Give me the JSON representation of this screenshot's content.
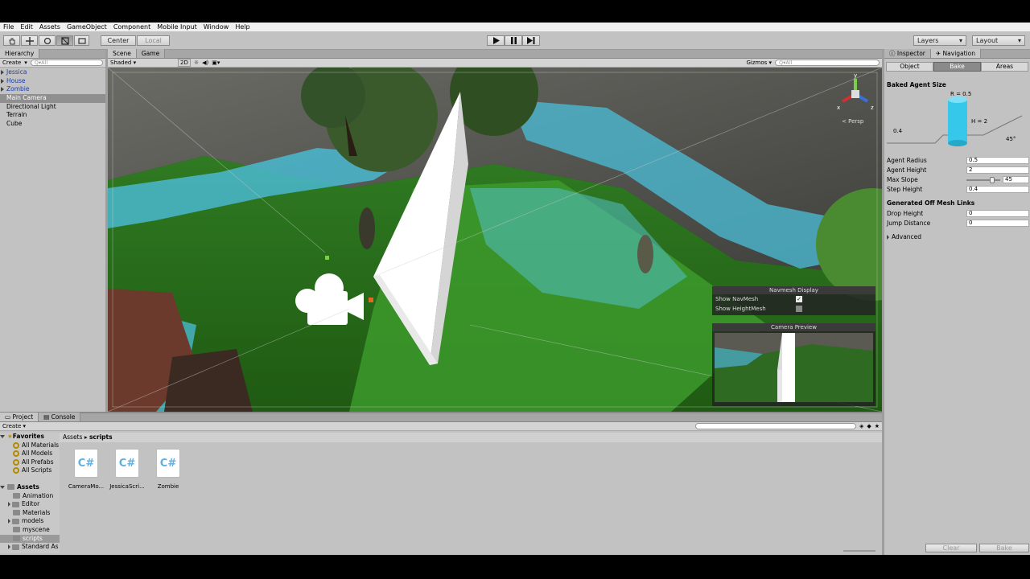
{
  "menu": [
    "File",
    "Edit",
    "Assets",
    "GameObject",
    "Component",
    "Mobile Input",
    "Window",
    "Help"
  ],
  "toolbar": {
    "center_label": "Center",
    "local_label": "Local",
    "layers_label": "Layers",
    "layout_label": "Layout"
  },
  "hierarchy": {
    "tab_label": "Hierarchy",
    "create_label": "Create",
    "search_placeholder": "Q▾All",
    "items": [
      {
        "label": "Jessica"
      },
      {
        "label": "House"
      },
      {
        "label": "Zombie"
      },
      {
        "label": "Main Camera"
      },
      {
        "label": "Directional Light"
      },
      {
        "label": "Terrain"
      },
      {
        "label": "Cube"
      }
    ]
  },
  "scene": {
    "tab_scene": "Scene",
    "tab_game": "Game",
    "shading": "Shaded",
    "mode_2d": "2D",
    "gizmos_label": "Gizmos",
    "search_placeholder": "Q▾All",
    "persp_label": "Persp",
    "gizmo_axes": {
      "y": "y",
      "x": "x",
      "z": "z"
    },
    "navmesh_display": {
      "title": "Navmesh Display",
      "show_navmesh": "Show NavMesh",
      "show_navmesh_checked": true,
      "show_heightmesh": "Show HeightMesh",
      "show_heightmesh_checked": false
    },
    "camera_preview": {
      "title": "Camera Preview"
    }
  },
  "inspector": {
    "tab_inspector": "Inspector",
    "tab_navigation": "Navigation",
    "subtabs": [
      "Object",
      "Bake",
      "Areas"
    ],
    "baked_agent_size": "Baked Agent Size",
    "diagram": {
      "r_label": "R = 0.5",
      "h_label": "H = 2",
      "step_label": "0.4",
      "slope_label": "45°"
    },
    "fields": [
      {
        "label": "Agent Radius",
        "value": "0.5"
      },
      {
        "label": "Agent Height",
        "value": "2"
      },
      {
        "label": "Max Slope",
        "value": "45"
      },
      {
        "label": "Step Height",
        "value": "0.4"
      }
    ],
    "max_slope_slider": {
      "value": 45,
      "max": 60
    },
    "offmesh_title": "Generated Off Mesh Links",
    "offmesh_fields": [
      {
        "label": "Drop Height",
        "value": "0"
      },
      {
        "label": "Jump Distance",
        "value": "0"
      }
    ],
    "advanced_label": "Advanced",
    "clear_label": "Clear",
    "bake_label": "Bake"
  },
  "project": {
    "tab_project": "Project",
    "tab_console": "Console",
    "create_label": "Create",
    "favorites_label": "Favorites",
    "favorites": [
      "All Materials",
      "All Models",
      "All Prefabs",
      "All Scripts"
    ],
    "assets_label": "Assets",
    "folders": [
      "Animation",
      "Editor",
      "Materials",
      "models",
      "myscene",
      "scripts",
      "Standard As"
    ],
    "breadcrumb": [
      "Assets",
      "scripts"
    ],
    "files": [
      {
        "icon": "C#",
        "name": "CameraMo..."
      },
      {
        "icon": "C#",
        "name": "JessicaScri..."
      },
      {
        "icon": "C#",
        "name": "Zombie"
      }
    ]
  }
}
